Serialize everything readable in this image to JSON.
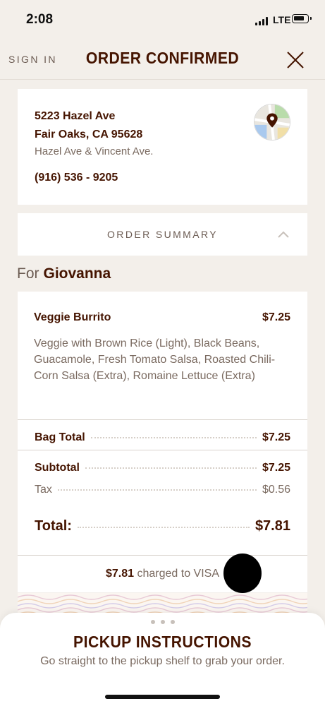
{
  "status_bar": {
    "time": "2:08",
    "network": "LTE"
  },
  "header": {
    "sign_in": "SIGN IN",
    "title": "ORDER CONFIRMED"
  },
  "location": {
    "address_line1": "5223 Hazel Ave",
    "address_line2": "Fair Oaks, CA 95628",
    "cross_streets": "Hazel Ave & Vincent Ave.",
    "phone": "(916) 536 - 9205"
  },
  "summary": {
    "label": "ORDER SUMMARY"
  },
  "order": {
    "for_label": "For",
    "name": "Giovanna",
    "item": {
      "name": "Veggie Burrito",
      "price": "$7.25",
      "description": "Veggie with Brown Rice (Light), Black Beans, Guacamole, Fresh Tomato Salsa, Roasted Chili-Corn Salsa (Extra), Romaine Lettuce (Extra)"
    },
    "bag_total_label": "Bag Total",
    "bag_total": "$7.25",
    "subtotal_label": "Subtotal",
    "subtotal": "$7.25",
    "tax_label": "Tax",
    "tax": "$0.56",
    "total_label": "Total:",
    "total": "$7.81",
    "charged_amount": "$7.81",
    "charged_text": "charged to VISA"
  },
  "pickup": {
    "title": "PICKUP INSTRUCTIONS",
    "text": "Go straight to the pickup shelf to grab your order."
  },
  "colors": {
    "brand_brown": "#451400",
    "muted_text": "#7a6a60",
    "background": "#f3efea"
  }
}
